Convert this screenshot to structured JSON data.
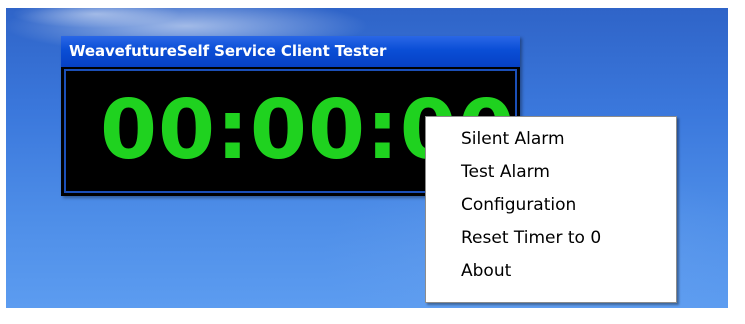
{
  "window": {
    "title": "WeavefutureSelf Service Client Tester",
    "timer": "00:00:00"
  },
  "context_menu": {
    "items": [
      "Silent Alarm",
      "Test Alarm",
      "Configuration",
      "Reset Timer to 0",
      "About"
    ]
  },
  "colors": {
    "timer_digits": "#1fd21f",
    "titlebar": "#0a4ed6",
    "desktop": "#3b78dc"
  }
}
